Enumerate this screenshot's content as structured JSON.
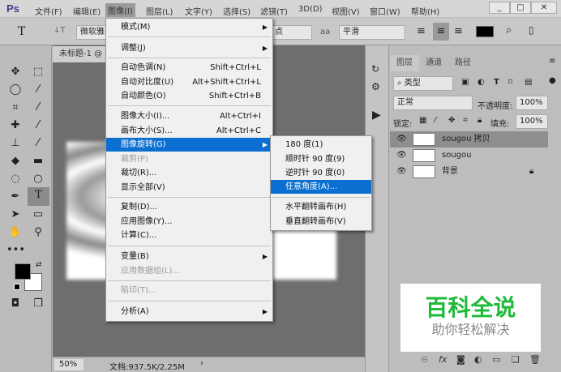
{
  "app": {
    "logo": "Ps",
    "menus": [
      "文件(F)",
      "编辑(E)",
      "图像(I)",
      "图层(L)",
      "文字(Y)",
      "选择(S)",
      "滤镜(T)",
      "3D(D)",
      "视图(V)",
      "窗口(W)",
      "帮助(H)"
    ],
    "window_controls": [
      "_",
      "□",
      "✕"
    ]
  },
  "options": {
    "font_family": "微软雅",
    "font_size_unit": "点",
    "aa_icon": "aa",
    "antialias": "平滑"
  },
  "document": {
    "tab": "未标题-1 @",
    "zoom": "50%",
    "doc_info": "文档:937.5K/2.25M",
    "arrow": "›"
  },
  "image_menu": {
    "items": [
      {
        "label": "模式(M)",
        "submenu": true
      },
      {
        "label": "调整(J)",
        "submenu": true
      },
      {
        "label": "自动色调(N)",
        "shortcut": "Shift+Ctrl+L"
      },
      {
        "label": "自动对比度(U)",
        "shortcut": "Alt+Shift+Ctrl+L"
      },
      {
        "label": "自动颜色(O)",
        "shortcut": "Shift+Ctrl+B"
      },
      {
        "label": "图像大小(I)...",
        "shortcut": "Alt+Ctrl+I"
      },
      {
        "label": "画布大小(S)...",
        "shortcut": "Alt+Ctrl+C"
      },
      {
        "label": "图像旋转(G)",
        "submenu": true,
        "highlighted": true
      },
      {
        "label": "裁剪(P)",
        "disabled": true
      },
      {
        "label": "裁切(R)..."
      },
      {
        "label": "显示全部(V)"
      },
      {
        "label": "复制(D)..."
      },
      {
        "label": "应用图像(Y)..."
      },
      {
        "label": "计算(C)..."
      },
      {
        "label": "变量(B)",
        "submenu": true
      },
      {
        "label": "应用数据组(L)...",
        "disabled": true
      },
      {
        "label": "陷印(T)...",
        "disabled": true
      },
      {
        "label": "分析(A)",
        "submenu": true
      }
    ]
  },
  "rotate_submenu": {
    "items": [
      "180 度(1)",
      "顺时针 90 度(9)",
      "逆时针 90 度(0)",
      "任意角度(A)...",
      "水平翻转画布(H)",
      "垂直翻转画布(V)"
    ]
  },
  "layers_panel": {
    "tabs": [
      "图层",
      "通道",
      "路径"
    ],
    "filter": "类型",
    "blend_mode": "正常",
    "opacity_label": "不透明度:",
    "opacity": "100%",
    "lock_label": "锁定:",
    "fill_label": "填充:",
    "fill": "100%",
    "layers": [
      {
        "name": "sougou 拷贝",
        "selected": true
      },
      {
        "name": "sougou"
      },
      {
        "name": "背景",
        "locked": true
      }
    ]
  },
  "watermark": {
    "title": "百科全说",
    "subtitle": "助你轻松解决"
  },
  "colors": {
    "accent": "#0a6fd0",
    "watermark_green": "#1fba3a"
  }
}
